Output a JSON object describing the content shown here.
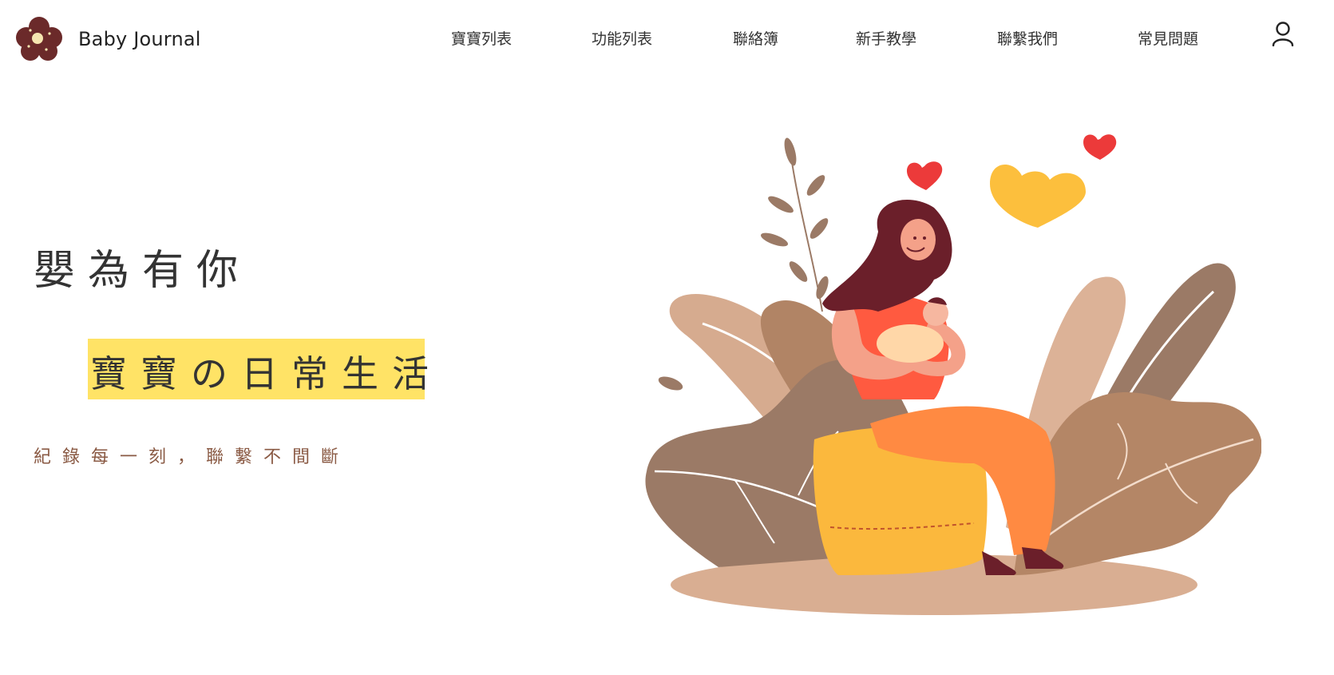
{
  "brand": {
    "name": "Baby Journal",
    "logo_icon": "flower-logo-icon"
  },
  "nav": {
    "items": [
      {
        "label": "寶寶列表"
      },
      {
        "label": "功能列表"
      },
      {
        "label": "聯絡簿"
      },
      {
        "label": "新手教學"
      },
      {
        "label": "聯繫我們"
      },
      {
        "label": "常見問題"
      }
    ],
    "user_icon": "user-icon"
  },
  "hero": {
    "title": "嬰為有你",
    "highlight": "寶寶の日常生活",
    "tagline": "紀錄每一刻，聯繫不間斷"
  },
  "colors": {
    "highlight": "#ffe366",
    "tagline": "#8a5a44",
    "logo": "#6b2a2a"
  }
}
